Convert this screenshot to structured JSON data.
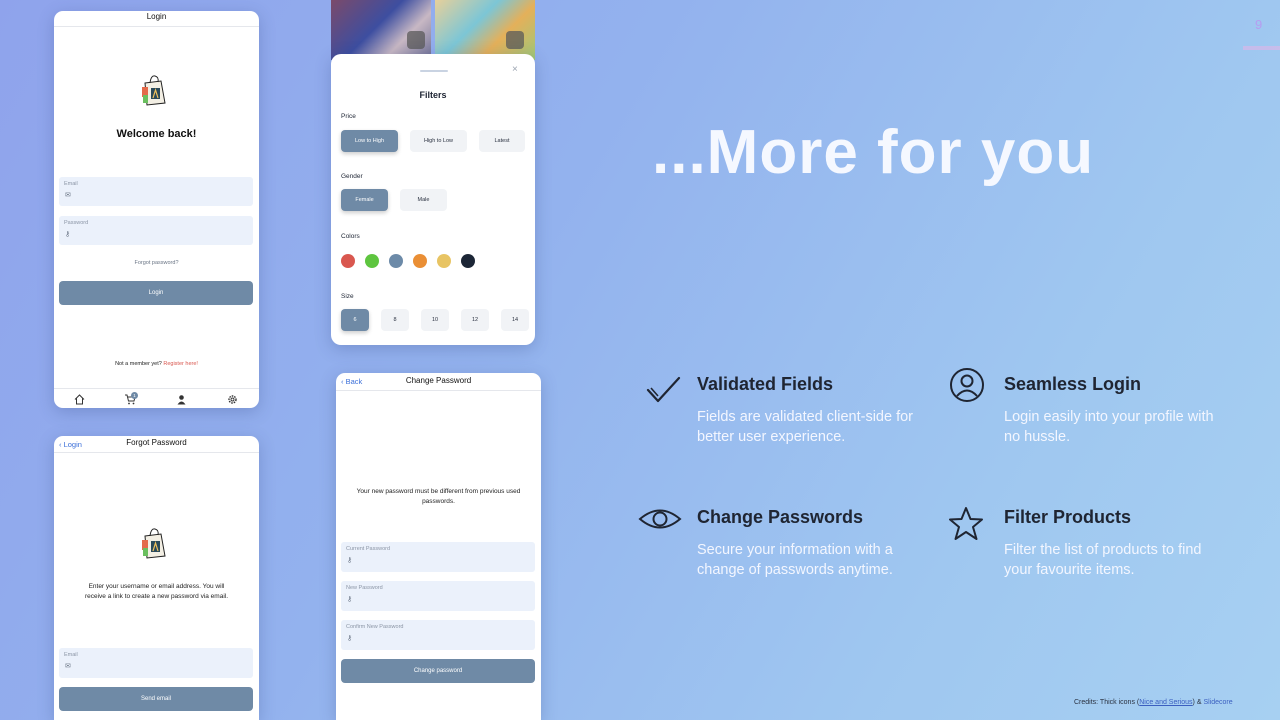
{
  "slide": {
    "number": "9"
  },
  "headline": "...More for you",
  "login": {
    "title": "Login",
    "welcome": "Welcome back!",
    "email_label": "Email",
    "password_label": "Password",
    "forgot": "Forgot password?",
    "button": "Login",
    "not_member": "Not a member yet?",
    "register": "Register here!",
    "cart_badge": "1"
  },
  "filters": {
    "title": "Filters",
    "price_label": "Price",
    "price_options": [
      "Low to High",
      "High to Low",
      "Latest"
    ],
    "gender_label": "Gender",
    "gender_options": [
      "Female",
      "Male"
    ],
    "colors_label": "Colors",
    "colors": [
      "#d9574f",
      "#5ec53f",
      "#6c8aa8",
      "#ea8f35",
      "#e8c463",
      "#1c2636"
    ],
    "size_label": "Size",
    "sizes": [
      "6",
      "8",
      "10",
      "12",
      "14"
    ]
  },
  "change_password": {
    "back": "Back",
    "title": "Change Password",
    "message": "Your new password must be different from previous used passwords.",
    "current_label": "Current Password",
    "new_label": "New Password",
    "confirm_label": "Confirm New Password",
    "button": "Change password"
  },
  "forgot_password": {
    "back": "Login",
    "title": "Forgot Password",
    "message": "Enter your username or email address. You will receive a link to create a new password via email.",
    "email_label": "Email",
    "button": "Send email"
  },
  "features": [
    {
      "icon": "checkmark-icon",
      "title": "Validated Fields",
      "desc": "Fields are validated client-side for better user experience."
    },
    {
      "icon": "user-circle-icon",
      "title": "Seamless Login",
      "desc": "Login easily into your profile with no hussle."
    },
    {
      "icon": "eye-icon",
      "title": "Change Passwords",
      "desc": "Secure your information with a change of passwords anytime."
    },
    {
      "icon": "star-icon",
      "title": "Filter Products",
      "desc": "Filter the list of products to find your favourite items."
    }
  ],
  "credits": {
    "prefix": "Credits: Thick icons (",
    "link1": "Nice and Serious",
    "mid": ") & ",
    "link2": "Slidecore"
  }
}
